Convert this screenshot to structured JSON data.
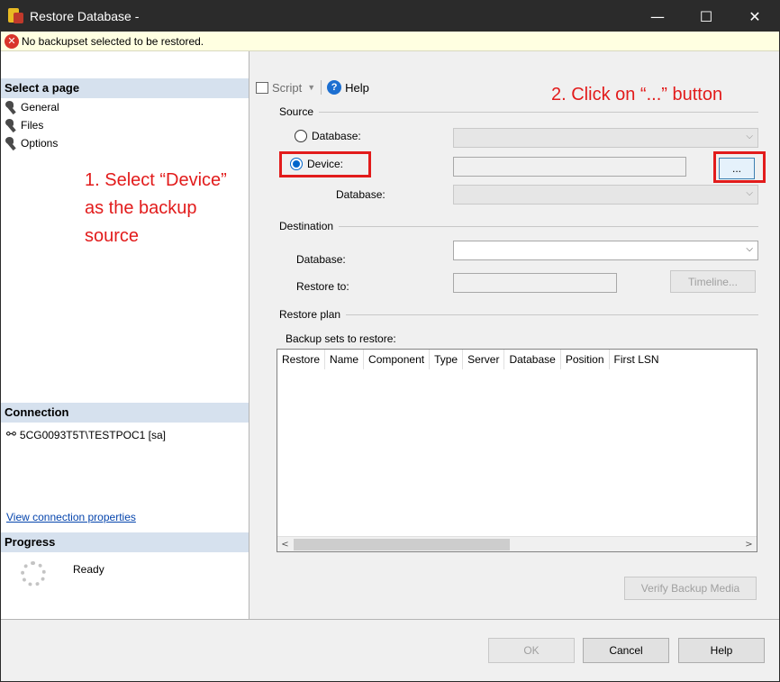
{
  "window": {
    "title": "Restore Database -",
    "controls": {
      "minimize": "—",
      "maximize": "☐",
      "close": "✕"
    }
  },
  "error_bar": {
    "icon": "error-icon",
    "message": "No backupset selected to be restored."
  },
  "left_pane": {
    "select_page_header": "Select a page",
    "pages": [
      {
        "label": "General",
        "icon": "wrench-icon"
      },
      {
        "label": "Files",
        "icon": "wrench-icon"
      },
      {
        "label": "Options",
        "icon": "wrench-icon"
      }
    ],
    "connection_header": "Connection",
    "connection_label": "5CG0093T5T\\TESTPOC1 [sa]",
    "view_connection_link": "View connection properties",
    "progress_header": "Progress",
    "progress_status": "Ready"
  },
  "toolbar": {
    "script_label": "Script",
    "help_label": "Help"
  },
  "source": {
    "group_label": "Source",
    "database_radio_label": "Database:",
    "device_radio_label": "Device:",
    "selected": "Device",
    "browse_button_label": "...",
    "database_label": "Database:"
  },
  "destination": {
    "group_label": "Destination",
    "database_label": "Database:",
    "restore_to_label": "Restore to:",
    "timeline_button_label": "Timeline..."
  },
  "restore_plan": {
    "group_label": "Restore plan",
    "backup_sets_label": "Backup sets to restore:",
    "columns": [
      "Restore",
      "Name",
      "Component",
      "Type",
      "Server",
      "Database",
      "Position",
      "First LSN"
    ],
    "verify_button_label": "Verify Backup Media"
  },
  "footer": {
    "ok_label": "OK",
    "cancel_label": "Cancel",
    "help_label": "Help"
  },
  "annotations": {
    "step1_lines": [
      "1. Select “Device”",
      "as the backup",
      "source"
    ],
    "step2": "2. Click on “...” button",
    "color": "#e21b1b"
  }
}
